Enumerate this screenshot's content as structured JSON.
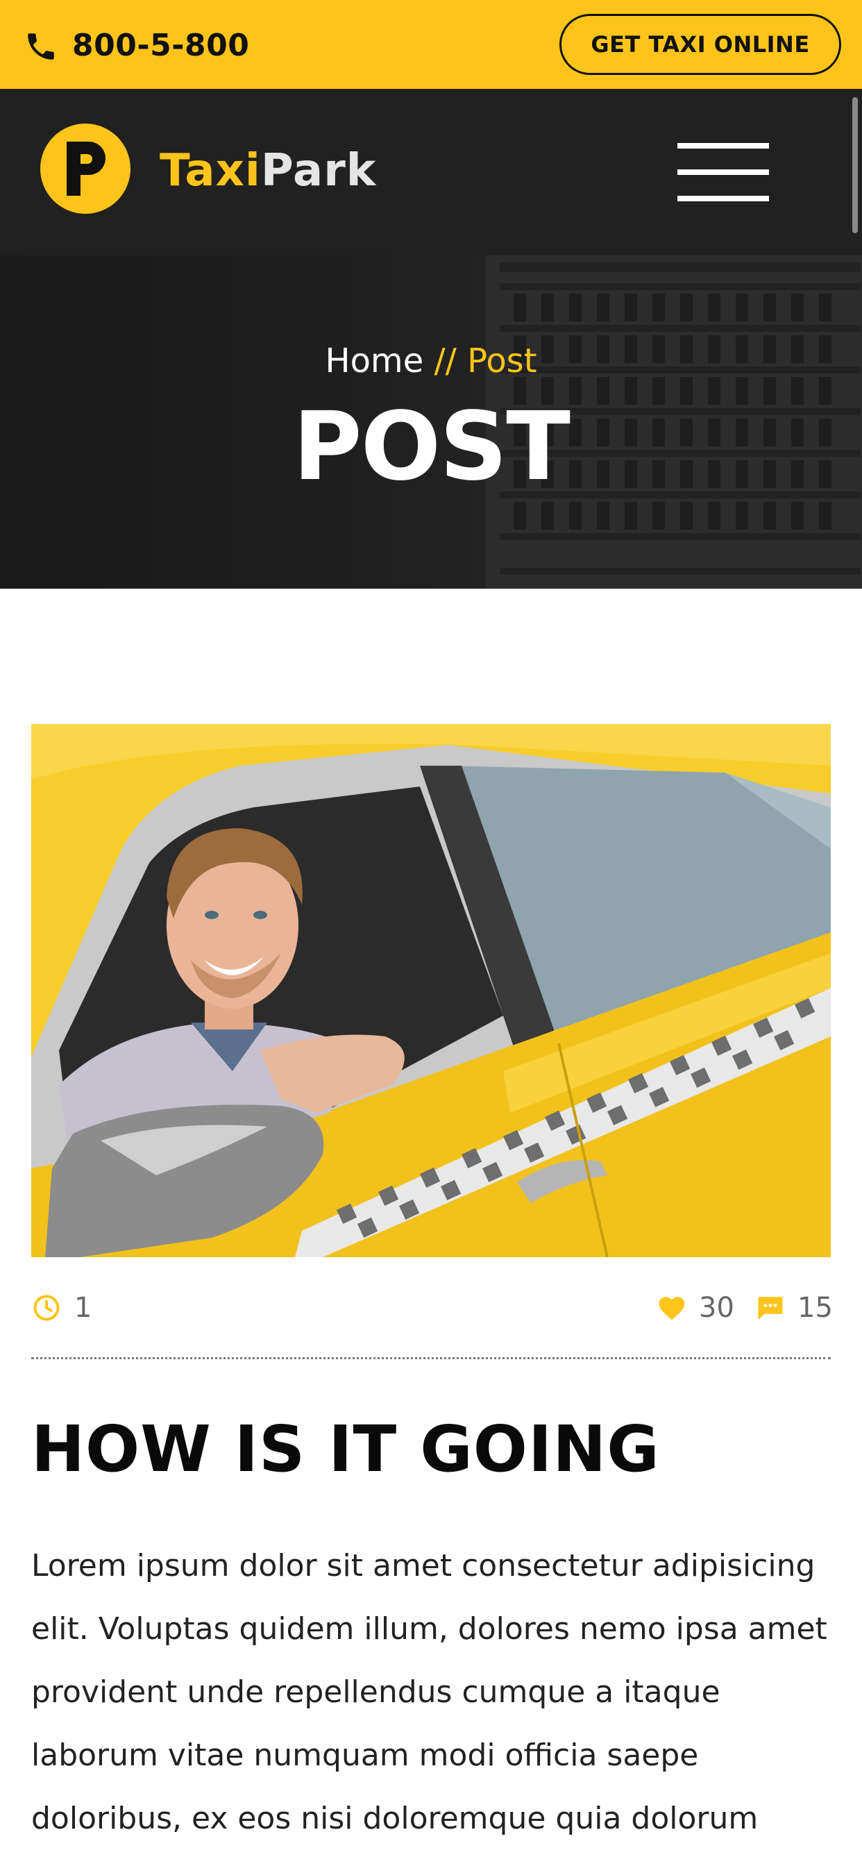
{
  "topbar": {
    "phone_icon": "phone-icon",
    "phone": "800-5-800",
    "cta_label": "GET TAXI ONLINE",
    "accent_color": "#fec41a"
  },
  "header": {
    "logo_icon": "taxipark-logo",
    "logo_text_1": "Taxi",
    "logo_text_2": "Park",
    "menu_icon": "hamburger-menu-icon",
    "background_color": "#212121"
  },
  "hero": {
    "breadcrumb_home": "Home",
    "breadcrumb_sep": " // ",
    "breadcrumb_current": "Post",
    "title": "POST"
  },
  "post": {
    "image_icon": "taxi-driver-photo",
    "meta": {
      "clock_icon": "clock-icon",
      "views": "1",
      "heart_icon": "heart-icon",
      "likes": "30",
      "comment_icon": "comment-icon",
      "comments": "15"
    },
    "title": "HOW IS IT GOING",
    "body": "Lorem ipsum dolor sit amet consectetur adipisicing elit. Voluptas quidem illum, dolores nemo ipsa amet provident unde repellendus cumque a itaque laborum vitae numquam modi officia saepe doloribus, ex eos nisi doloremque quia dolorum"
  }
}
